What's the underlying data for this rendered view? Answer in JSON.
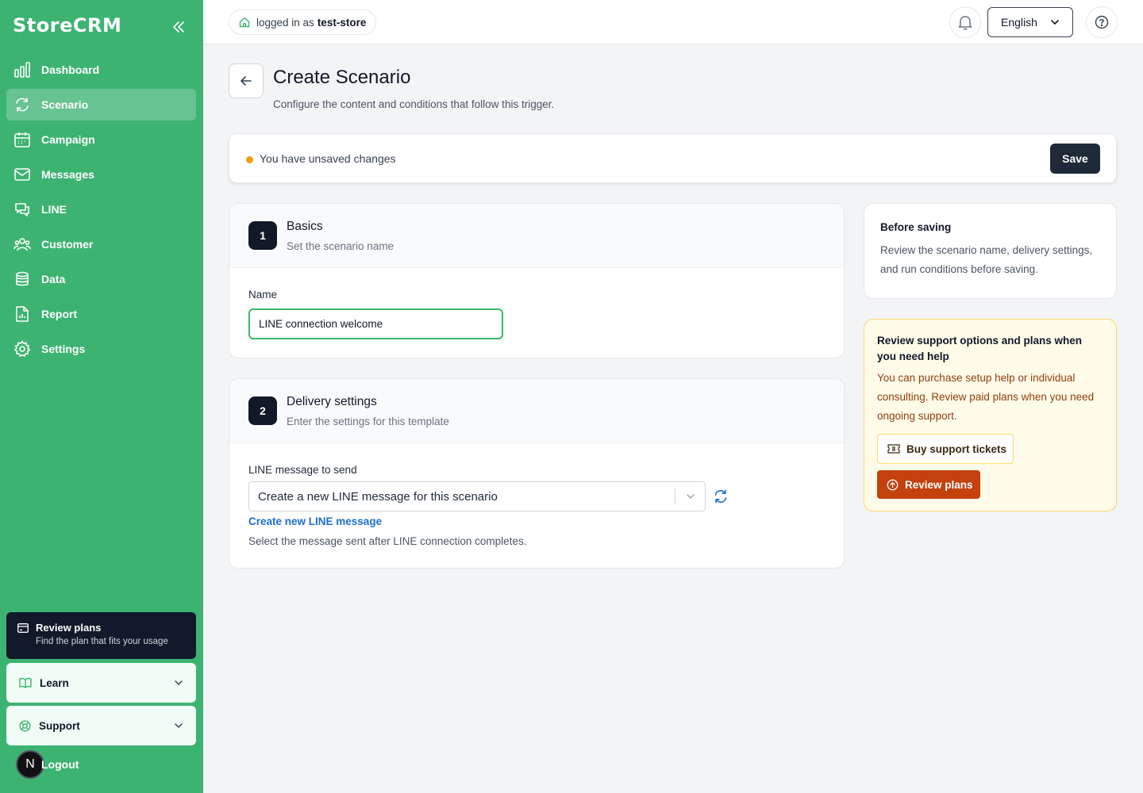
{
  "sidebar": {
    "brand": "StoreCRM",
    "items": [
      {
        "label": "Dashboard",
        "icon": "bar-chart-icon"
      },
      {
        "label": "Scenario",
        "icon": "refresh-icon",
        "active": true
      },
      {
        "label": "Campaign",
        "icon": "calendar-icon"
      },
      {
        "label": "Messages",
        "icon": "mail-icon"
      },
      {
        "label": "LINE",
        "icon": "chat-icon"
      },
      {
        "label": "Customer",
        "icon": "users-icon"
      },
      {
        "label": "Data",
        "icon": "database-icon"
      },
      {
        "label": "Report",
        "icon": "report-icon"
      },
      {
        "label": "Settings",
        "icon": "gear-icon"
      }
    ],
    "plan_card": {
      "title": "Review plans",
      "subtitle": "Find the plan that fits your usage"
    },
    "learn": "Learn",
    "support": "Support",
    "logout": "Logout",
    "avatar_letter": "N"
  },
  "header": {
    "logged_in_prefix": "logged in as",
    "store_name": "test-store",
    "language": "English"
  },
  "page": {
    "title": "Create Scenario",
    "subtitle": "Configure the content and conditions that follow this trigger."
  },
  "unsaved_bar": {
    "text": "You have unsaved changes",
    "save_label": "Save",
    "dot_color": "#f59e0b"
  },
  "basics": {
    "step": "1",
    "title": "Basics",
    "subtitle": "Set the scenario name",
    "name_label": "Name",
    "name_value": "LINE connection welcome"
  },
  "delivery": {
    "step": "2",
    "title": "Delivery settings",
    "subtitle": "Enter the settings for this template",
    "message_label": "LINE message to send",
    "selected_option": "Create a new LINE message for this scenario",
    "create_link": "Create new LINE message",
    "help_text": "Select the message sent after LINE connection completes."
  },
  "before_saving": {
    "title": "Before saving",
    "text": "Review the scenario name, delivery settings, and run conditions before saving."
  },
  "support_card": {
    "title": "Review support options and plans when you need help",
    "text": "You can purchase setup help or individual consulting. Review paid plans when you need ongoing support.",
    "tickets_label": "Buy support tickets",
    "plans_label": "Review plans"
  },
  "colors": {
    "sidebar_bg": "#3db372",
    "accent_orange": "#c2410c",
    "link_blue": "#1d6fc8"
  }
}
